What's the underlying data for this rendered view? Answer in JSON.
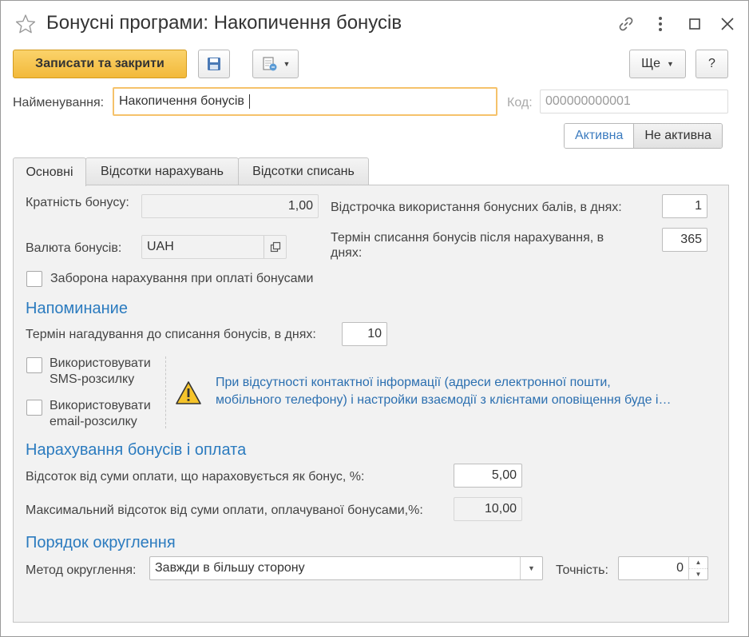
{
  "window": {
    "title": "Бонусні програми: Накопичення бонусів",
    "icons": [
      "star-icon",
      "link-icon",
      "more-vertical-icon",
      "maximize-icon",
      "close-icon"
    ]
  },
  "toolbar": {
    "save_close_label": "Записати та закрити",
    "more_label": "Ще",
    "help_label": "?"
  },
  "header": {
    "name_label": "Найменування:",
    "name_value": "Накопичення бонусів",
    "code_label": "Код:",
    "code_value": "000000000001",
    "status_active": "Активна",
    "status_inactive": "Не активна"
  },
  "tabs": [
    {
      "label": "Основні",
      "active": true
    },
    {
      "label": "Відсотки нарахувань",
      "active": false
    },
    {
      "label": "Відсотки списань",
      "active": false
    }
  ],
  "main": {
    "multiplicity_label": "Кратність бонусу:",
    "multiplicity_value": "1,00",
    "currency_label": "Валюта бонусів:",
    "currency_value": "UAH",
    "deferral_label": "Відстрочка використання бонусних балів, в днях:",
    "deferral_value": "1",
    "writeoff_term_label": "Термін списання бонусів після нарахування, в днях:",
    "writeoff_term_value": "365",
    "ban_accrual_label": "Заборона нарахування при оплаті бонусами"
  },
  "reminder": {
    "title": "Напоминание",
    "term_label": "Термін нагадування до списання бонусів, в днях:",
    "term_value": "10",
    "use_sms_label": "Використовувати SMS-розсилку",
    "use_email_label": "Використовувати email-розсилку",
    "warning_line1": "При відсутності контактної інформації (адреси електронної пошти,",
    "warning_line2": "мобільного телефону) і настройки взаємодії з клієнтами оповіщення буде і…"
  },
  "accrual": {
    "title": "Нарахування бонусів і оплата",
    "percent_label": "Відсоток від суми оплати, що нараховується як бонус, %:",
    "percent_value": "5,00",
    "max_percent_label": "Максимальний відсоток від суми оплати, оплачуваної бонусами,%:",
    "max_percent_value": "10,00"
  },
  "rounding": {
    "title": "Порядок округлення",
    "method_label": "Метод округлення:",
    "method_value": "Завжди в більшу сторону",
    "precision_label": "Точність:",
    "precision_value": "0"
  },
  "colors": {
    "accent": "#2b7bbf",
    "primary_button": "#f2b93a",
    "focus": "#f5c26b"
  }
}
